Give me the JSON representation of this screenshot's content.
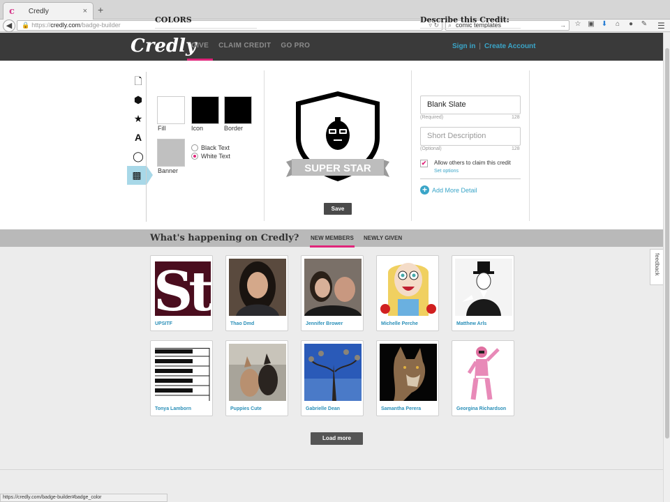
{
  "browser": {
    "tab_title": "Credly",
    "tab_favicon": "c",
    "close_glyph": "×",
    "new_tab_glyph": "+",
    "url_prefix": "https://",
    "url_host": "credly.com",
    "url_path": "/badge-builder",
    "search_value": "comic templates",
    "status_url": "https://credly.com/badge-builder#badge_color"
  },
  "site": {
    "logo": "Credly",
    "nav": [
      "GIVE",
      "CLAIM CREDIT",
      "GO PRO"
    ],
    "sign_in": "Sign in",
    "separator": "|",
    "create_account": "Create Account",
    "accent_color": "#e0247a",
    "link_color": "#3aa5c8"
  },
  "tools": {
    "text_tool_glyph": "A"
  },
  "colors_panel": {
    "title": "COLORS",
    "swatches": [
      {
        "label": "Fill",
        "color": "#ffffff"
      },
      {
        "label": "Icon",
        "color": "#000000"
      },
      {
        "label": "Border",
        "color": "#000000"
      },
      {
        "label": "Banner",
        "color": "#c0c0c0"
      }
    ],
    "text_options": [
      "Black Text",
      "White Text"
    ],
    "selected_text_option": "White Text"
  },
  "badge": {
    "banner_text": "SUPER STAR",
    "save_label": "Save"
  },
  "describe": {
    "title": "Describe this Credit:",
    "title_value": "Blank Slate",
    "title_hint": "(Required)",
    "title_count": "128",
    "desc_placeholder": "Short Description",
    "desc_hint": "(Optional)",
    "desc_count": "128",
    "allow_label": "Allow others to claim this credit",
    "allow_checked": true,
    "check_glyph": "✔",
    "set_options": "Set options",
    "add_more_glyph": "+",
    "add_more": "Add More Detail"
  },
  "feed": {
    "title": "What's happening on Credly?",
    "tabs": [
      "NEW MEMBERS",
      "NEWLY GIVEN"
    ],
    "active_tab": "NEW MEMBERS",
    "feedback_label": "feedback",
    "members": [
      {
        "name": "UPSITF"
      },
      {
        "name": "Thao Dmd"
      },
      {
        "name": "Jennifer Brower"
      },
      {
        "name": "Michelle Perche"
      },
      {
        "name": "Matthew Arls"
      },
      {
        "name": "Tonya Lamborn"
      },
      {
        "name": "Puppies Cute"
      },
      {
        "name": "Gabrielle Dean"
      },
      {
        "name": "Samantha Perera"
      },
      {
        "name": "Georgina Richardson"
      }
    ],
    "load_more": "Load more"
  }
}
